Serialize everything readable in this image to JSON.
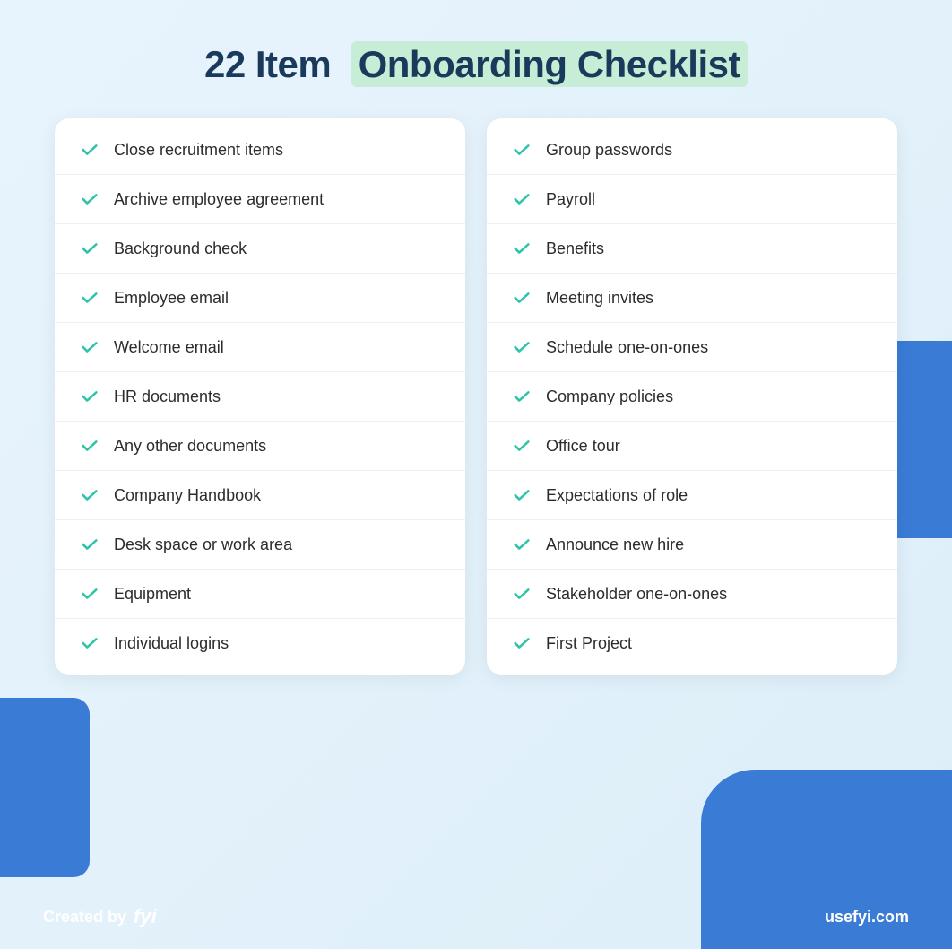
{
  "header": {
    "title_prefix": "22 Item",
    "title_highlight": "Onboarding Checklist"
  },
  "left_column": {
    "items": [
      "Close recruitment items",
      "Archive employee agreement",
      "Background check",
      "Employee email",
      "Welcome email",
      "HR documents",
      "Any other documents",
      "Company Handbook",
      "Desk space or work area",
      "Equipment",
      "Individual logins"
    ]
  },
  "right_column": {
    "items": [
      "Group passwords",
      "Payroll",
      "Benefits",
      "Meeting invites",
      "Schedule one-on-ones",
      "Company policies",
      "Office tour",
      "Expectations of role",
      "Announce new hire",
      "Stakeholder one-on-ones",
      "First Project"
    ]
  },
  "footer": {
    "created_by_label": "Created by",
    "brand_name": "fyi",
    "url": "usefyi.com"
  }
}
